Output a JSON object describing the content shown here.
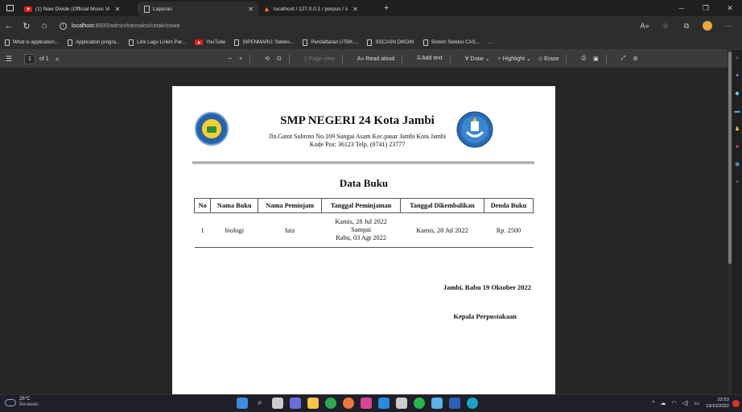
{
  "browser": {
    "tabs": [
      {
        "title": "(1) New Divide (Official Music Vi",
        "icon": "youtube-icon"
      },
      {
        "title": "Laporan",
        "icon": "page-icon"
      },
      {
        "title": "localhost / 127.0.0.1 / perpus / s",
        "icon": "phpmyadmin-icon"
      }
    ],
    "url": {
      "host": "localhost",
      "rest": ":8000/admin/transaksi/cetak/siswa"
    },
    "bookmarks": [
      "What is application...",
      "Application progra...",
      "Link Lagu Linkin Par...",
      "YouTube",
      "SIPENMARU: Seleks...",
      "Pendaftaran UTBK-...",
      "SSCASN DIKDIN",
      "Sistem Seleksi CAS..."
    ],
    "bookmarks_more": "..."
  },
  "pdf_toolbar": {
    "page": "1",
    "of": "of 1",
    "page_view": "Page view",
    "read_aloud": "Read aloud",
    "add_text": "Add text",
    "draw": "Draw",
    "highlight": "Highlight",
    "erase": "Erase"
  },
  "document": {
    "school_name": "SMP NEGERI 24 Kota Jambi",
    "address_line1": "Jln.Gatot Subroto No.169 Sungai Asam Kec.pasar Jambi Kota Jambi",
    "address_line2": "Kode Pos: 36123 Telp. (0741) 23777",
    "title": "Data Buku",
    "table": {
      "headers": [
        "No",
        "Nama Buku",
        "Nama Peminjam",
        "Tanggal Peminjaman",
        "Tanggal Dikembalikan",
        "Denda Buku"
      ],
      "rows": [
        {
          "no": "1",
          "nama_buku": "biologi",
          "nama_peminjam": "faiz",
          "tgl_pinjam_1": "Kamis, 28 Jul 2022",
          "tgl_pinjam_2": "Sampai",
          "tgl_pinjam_3": "Rabu, 03 Agt 2022",
          "tgl_kembali": "Kamis, 28 Jul 2022",
          "denda": "Rp. 2500"
        }
      ]
    },
    "place_date": "Jambi, Rabu 19 Oktober 2022",
    "signer": "Kepala Perpustakaan"
  },
  "taskbar": {
    "temperature": "26°C",
    "weather": "Berawan",
    "time": "22:53",
    "date": "19/10/2022"
  }
}
